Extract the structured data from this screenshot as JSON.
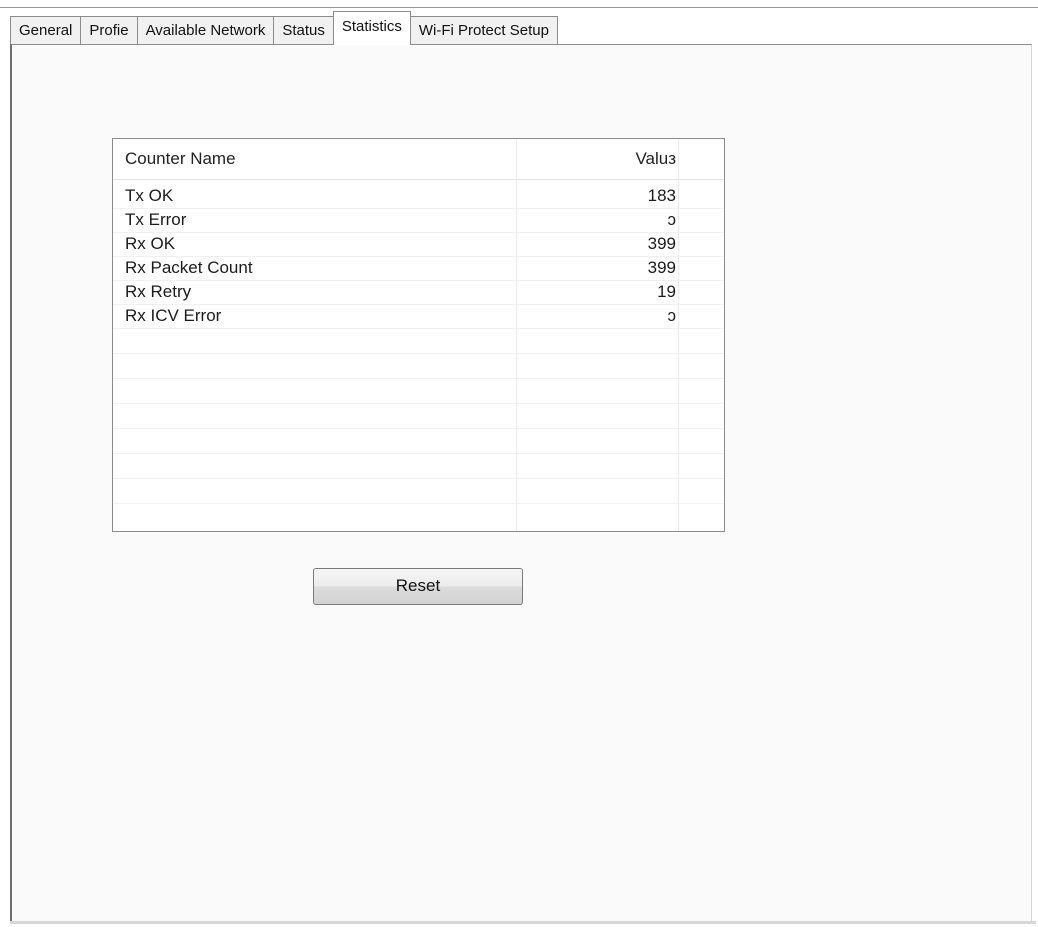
{
  "tabs": [
    {
      "label": "General"
    },
    {
      "label": "Profie"
    },
    {
      "label": "Available Network"
    },
    {
      "label": "Status"
    },
    {
      "label": "Statistics",
      "active": true
    },
    {
      "label": "Wi-Fi Protect Setup"
    }
  ],
  "statistics": {
    "columns": {
      "name": "Counter Name",
      "value": "Valuз"
    },
    "rows": [
      {
        "name": "Tx OK",
        "value": "183"
      },
      {
        "name": "Tx Error",
        "value": "ɔ"
      },
      {
        "name": "Rx OK",
        "value": "399"
      },
      {
        "name": "Rx Packet Count",
        "value": "399"
      },
      {
        "name": "Rx Retry",
        "value": "19"
      },
      {
        "name": "Rx ICV Error",
        "value": "ɔ"
      }
    ]
  },
  "buttons": {
    "reset_label": "Reset"
  }
}
